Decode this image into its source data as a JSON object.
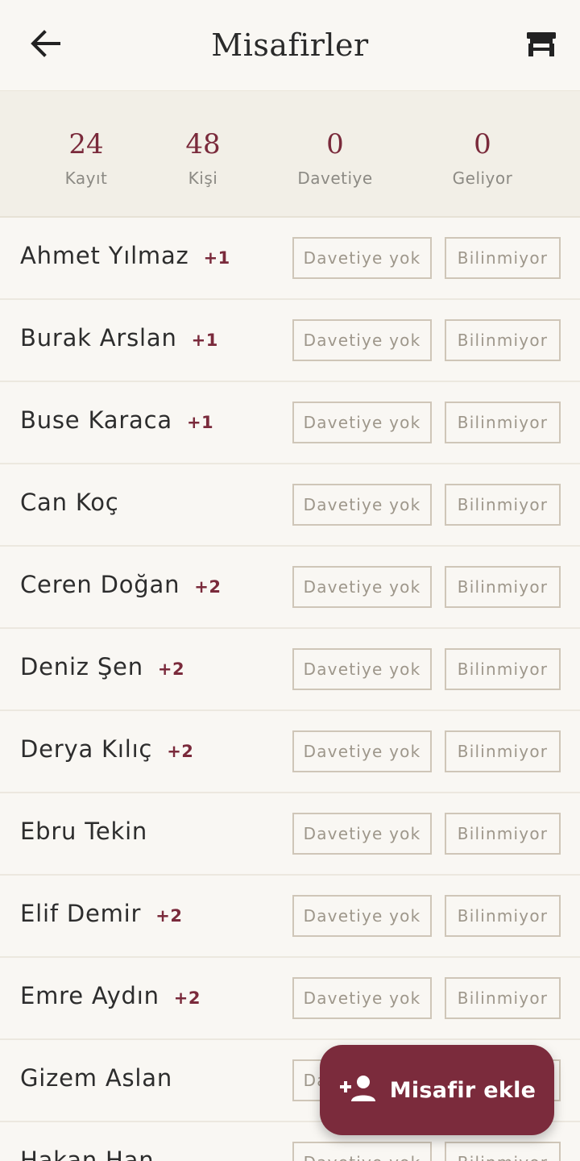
{
  "header": {
    "title": "Misafirler",
    "back_icon": "arrow-left-icon",
    "seating_icon": "table-seating-icon"
  },
  "stats": [
    {
      "value": "24",
      "label": "Kayıt"
    },
    {
      "value": "48",
      "label": "Kişi"
    },
    {
      "value": "0",
      "label": "Davetiye"
    },
    {
      "value": "0",
      "label": "Geliyor"
    }
  ],
  "guests": [
    {
      "name": "Ahmet Yılmaz",
      "plus": "+1",
      "invite": "Davetiye yok",
      "status": "Bilinmiyor"
    },
    {
      "name": "Burak Arslan",
      "plus": "+1",
      "invite": "Davetiye yok",
      "status": "Bilinmiyor"
    },
    {
      "name": "Buse Karaca",
      "plus": "+1",
      "invite": "Davetiye yok",
      "status": "Bilinmiyor"
    },
    {
      "name": "Can Koç",
      "plus": "",
      "invite": "Davetiye yok",
      "status": "Bilinmiyor"
    },
    {
      "name": "Ceren Doğan",
      "plus": "+2",
      "invite": "Davetiye yok",
      "status": "Bilinmiyor"
    },
    {
      "name": "Deniz Şen",
      "plus": "+2",
      "invite": "Davetiye yok",
      "status": "Bilinmiyor"
    },
    {
      "name": "Derya Kılıç",
      "plus": "+2",
      "invite": "Davetiye yok",
      "status": "Bilinmiyor"
    },
    {
      "name": "Ebru Tekin",
      "plus": "",
      "invite": "Davetiye yok",
      "status": "Bilinmiyor"
    },
    {
      "name": "Elif Demir",
      "plus": "+2",
      "invite": "Davetiye yok",
      "status": "Bilinmiyor"
    },
    {
      "name": "Emre Aydın",
      "plus": "+2",
      "invite": "Davetiye yok",
      "status": "Bilinmiyor"
    },
    {
      "name": "Gizem Aslan",
      "plus": "",
      "invite": "Davetiye yok",
      "status": "Bilinmiyor"
    },
    {
      "name": "Hakan Han",
      "plus": "",
      "invite": "Davetiye yok",
      "status": "Bilinmiyor"
    }
  ],
  "fab": {
    "label": "Misafir ekle",
    "icon": "add-person-icon"
  },
  "colors": {
    "accent": "#7b2b3c",
    "background": "#f9f7f3",
    "stats_background": "#f2efe7",
    "chip_border": "#cfc6b8"
  }
}
